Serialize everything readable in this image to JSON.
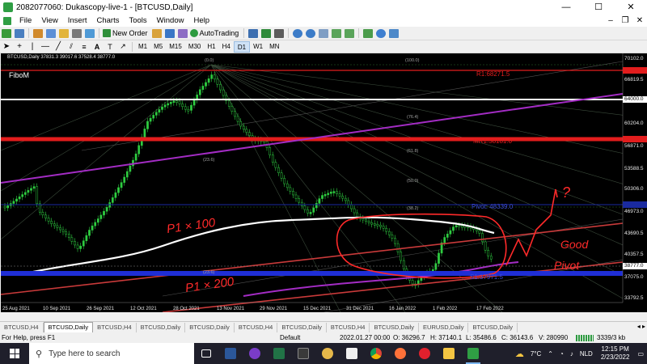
{
  "window": {
    "title": "2082077060: Dukascopy-live-1 - [BTCUSD,Daily]",
    "minimize": "—",
    "maximize": "☐",
    "close": "✕"
  },
  "menu": {
    "items": [
      "File",
      "View",
      "Insert",
      "Charts",
      "Tools",
      "Window",
      "Help"
    ],
    "mdi_minimize": "–",
    "mdi_restore": "❐",
    "mdi_close": "✕"
  },
  "toolbar": {
    "new_order": "New Order",
    "autotrading": "AutoTrading",
    "timeframes": [
      "M1",
      "M5",
      "M15",
      "M30",
      "H1",
      "H4",
      "D1",
      "W1",
      "MN"
    ],
    "active_timeframe": "D1"
  },
  "chart": {
    "header": "BTCUSD,Daily  37831.3 39017.6 37528.4 38777.0",
    "indicator_name": "FiboM",
    "price_labels": [
      "70102.0",
      "66819.5",
      "64000.0",
      "60204.0",
      "56871.0",
      "53588.5",
      "50306.0",
      "46973.0",
      "43690.5",
      "40357.5",
      "38777.0",
      "37075.0",
      "33792.5"
    ],
    "date_labels": [
      "25 Aug 2021",
      "10 Sep 2021",
      "26 Sep 2021",
      "12 Oct 2021",
      "28 Oct 2021",
      "13 Nov 2021",
      "29 Nov 2021",
      "15 Dec 2021",
      "31 Dec 2021",
      "16 Jan 2022",
      "1 Feb 2022",
      "17 Feb 2022"
    ],
    "pivot_labels": {
      "r1": "R1:68271.5",
      "mr1": "MR1:58181.0",
      "pivot": "Pivot: 48339.0",
      "s1": "S1:37971.5"
    },
    "fib_levels": [
      "(0.0)",
      "(100.0)",
      "(23.6)",
      "(76.4)",
      "(61.8)",
      "(50.0)",
      "(38.2)",
      "(23.6)"
    ],
    "colors": {
      "background": "#000000",
      "bull": "#2ecc40",
      "r1_line": "#e21d1d",
      "white_line": "#ffffff",
      "blue_line": "#1f2ed6",
      "purple_channel": "#a32cc4",
      "red_channel": "#c93a3a",
      "annotation_red": "#ff2a2a"
    },
    "annotations": [
      "P1 × 100",
      "P1 × 200",
      "?",
      "Good",
      "Pivot"
    ]
  },
  "tabs": {
    "items": [
      "BTCUSD,H4",
      "BTCUSD,Daily",
      "BTCUSD,H4",
      "BTCUSD,Daily",
      "BTCUSD,Daily",
      "BTCUSD,H4",
      "BTCUSD,Daily",
      "BTCUSD,H4",
      "BTCUSD,Daily",
      "EURUSD,Daily",
      "BTCUSD,Daily"
    ],
    "active_index": 1
  },
  "status": {
    "help": "For Help, press F1",
    "profile": "Default",
    "datetime": "2022.01.27 00:00",
    "open": "O: 36296.7",
    "high": "H: 37140.1",
    "low": "L: 35486.6",
    "close": "C: 36143.6",
    "volume": "V: 280990",
    "traffic": "3339/3 kb"
  },
  "taskbar": {
    "search_placeholder": "Type here to search",
    "temperature": "7°C",
    "language": "NLD",
    "time": "12:15 PM",
    "date": "2/23/2022"
  }
}
